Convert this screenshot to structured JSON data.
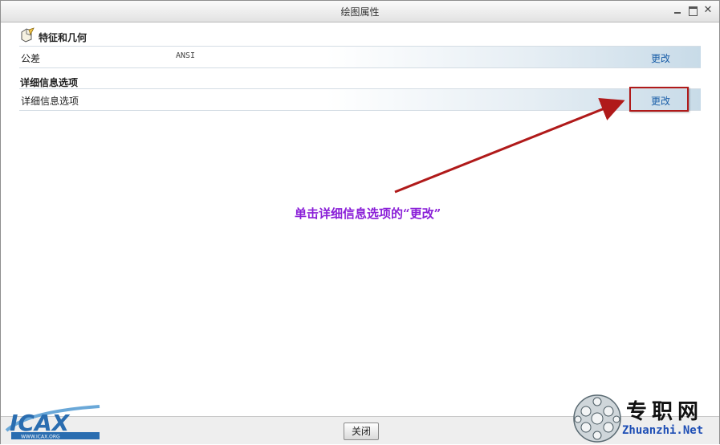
{
  "window": {
    "title": "绘图属性"
  },
  "sections": [
    {
      "heading": "特征和几何",
      "rows": [
        {
          "label": "公差",
          "value": "ANSI",
          "action": "更改"
        }
      ]
    },
    {
      "heading": "详细信息选项",
      "rows": [
        {
          "label": "详细信息选项",
          "value": "",
          "action": "更改"
        }
      ]
    }
  ],
  "annotation": {
    "text": "单击详细信息选项的“更改”",
    "color": "#8a1fd8",
    "arrow_color": "#b01a1a"
  },
  "footer": {
    "close_label": "关闭"
  },
  "watermarks": {
    "icax_text": "ICAX",
    "icax_sub": "WWW.ICAX.ORG",
    "zhuanzhi_cn": "专职网",
    "zhuanzhi_en": "Zhuanzhi.Net"
  }
}
